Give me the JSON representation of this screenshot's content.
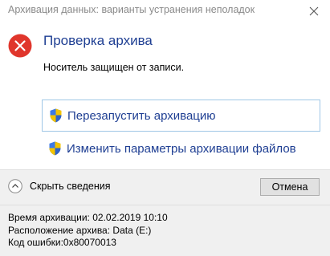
{
  "window": {
    "title": "Архивация данных: варианты устранения неполадок",
    "close_icon": "close-icon"
  },
  "main": {
    "status_icon": "error-icon",
    "heading": "Проверка архива",
    "message": "Носитель защищен от записи."
  },
  "commands": [
    {
      "label": "Перезапустить архивацию",
      "icon": "uac-shield-icon"
    },
    {
      "label": "Изменить параметры архивации файлов",
      "icon": "uac-shield-icon"
    }
  ],
  "footer": {
    "toggle_label": "Скрыть сведения",
    "toggle_icon": "chevron-up-icon",
    "cancel_label": "Отмена"
  },
  "details": {
    "backup_time": "Время архивации: 02.02.2019 10:10",
    "backup_location": "Расположение архива: Data (E:)",
    "error_code": "Код ошибки:0x80070013"
  },
  "colors": {
    "heading": "#1f3f93",
    "error_red": "#e0362c",
    "footer_bg": "#f0f0f0"
  }
}
